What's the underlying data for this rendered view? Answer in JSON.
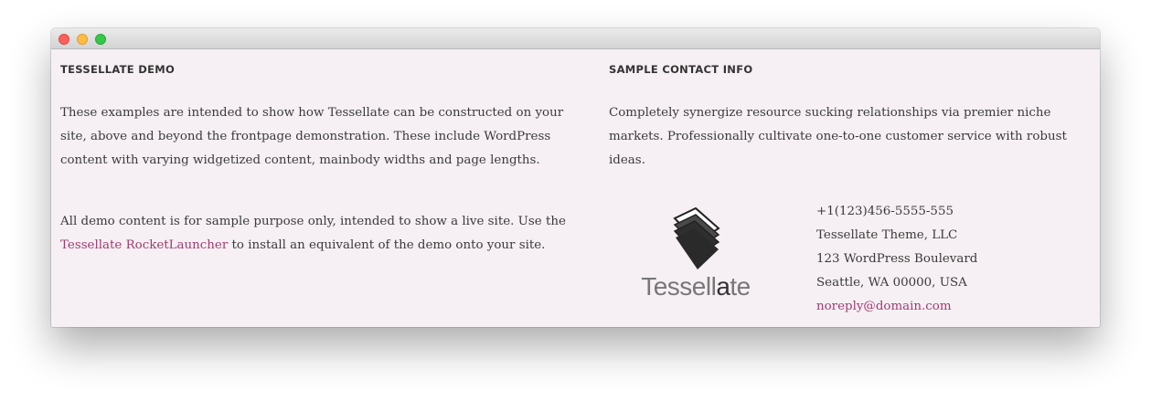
{
  "window": {
    "controls": [
      "close",
      "minimize",
      "maximize"
    ]
  },
  "left": {
    "title": "TESSELLATE DEMO",
    "paragraph1": "These examples are intended to show how Tessellate can be constructed on your site, above and beyond the frontpage demonstration. These include WordPress content with varying widgetized content, mainbody widths and page lengths.",
    "paragraph2_before": "All demo content is for sample purpose only, intended to show a live site. Use the ",
    "paragraph2_link": "Tessellate RocketLauncher",
    "paragraph2_after": " to install an equivalent of the demo onto your site."
  },
  "right": {
    "title": "SAMPLE CONTACT INFO",
    "paragraph1": "Completely synergize resource sucking relationships via premier niche markets. Professionally cultivate one-to-one customer service with robust ideas.",
    "logo": {
      "text_light": "Tessell",
      "text_dark": "a",
      "text_end": "te",
      "icon": "stacked-tiles-icon"
    },
    "contact": {
      "phone": "+1(123)456-5555-555",
      "company": "Tessellate Theme, LLC",
      "address": "123 WordPress Boulevard",
      "city": "Seattle, WA 00000, USA",
      "email": "noreply@domain.com"
    }
  },
  "colors": {
    "background": "#f6f0f4",
    "link": "#a33a6e",
    "text": "#3a3a3a"
  }
}
